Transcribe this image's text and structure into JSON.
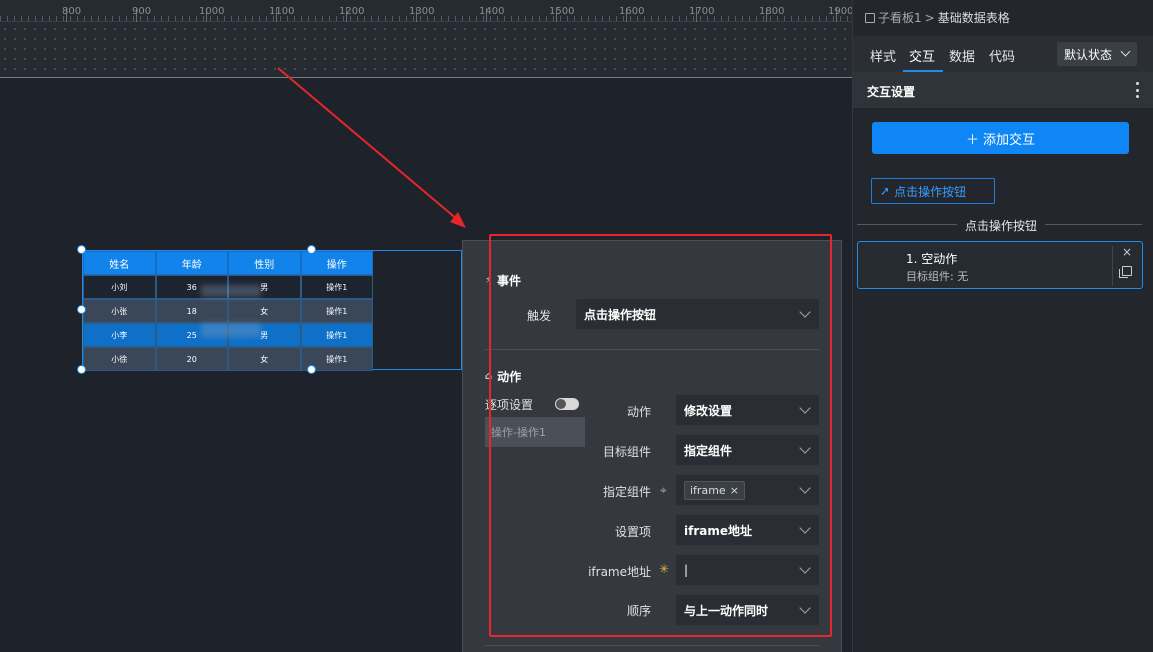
{
  "ruler": {
    "ticks": [
      "800",
      "900",
      "1000",
      "1100",
      "1200",
      "1300",
      "1400",
      "1500",
      "1600",
      "1700",
      "1800",
      "1900"
    ]
  },
  "table": {
    "headers": [
      "姓名",
      "年龄",
      "性别",
      "操作"
    ],
    "rows": [
      [
        "小刘",
        "36",
        "男",
        "操作1"
      ],
      [
        "小张",
        "18",
        "女",
        "操作1"
      ],
      [
        "小李",
        "25",
        "男",
        "操作1"
      ],
      [
        "小徐",
        "20",
        "女",
        "操作1"
      ]
    ]
  },
  "popup": {
    "event_section": {
      "icon": "lightning-icon",
      "title": "事件",
      "trigger_label": "触发",
      "trigger_value": "点击操作按钮"
    },
    "action_section": {
      "icon": "action-icon",
      "title": "动作",
      "item_settings_label": "逐项设置",
      "item_list_entry": "操作-操作1",
      "action_label": "动作",
      "action_value": "修改设置",
      "target_label": "目标组件",
      "target_value": "指定组件",
      "specified_label": "指定组件",
      "specified_tag": "iframe",
      "specified_tag_close": "×",
      "setting_label": "设置项",
      "setting_value": "iframe地址",
      "iframe_url_label": "iframe地址",
      "iframe_url_value": "|",
      "order_label": "顺序",
      "order_value": "与上一动作同时"
    }
  },
  "panel": {
    "breadcrumb": {
      "parent": "子看板1",
      "separator": ">",
      "current": "基础数据表格"
    },
    "tabs": [
      "样式",
      "交互",
      "数据",
      "代码"
    ],
    "active_tab": "交互",
    "state_select": "默认状态",
    "section_title": "交互设置",
    "add_button": "添加交互",
    "add_button_icon": "＋",
    "event_button": "点击操作按钮",
    "divider_label": "点击操作按钮",
    "action_card": {
      "title": "1. 空动作",
      "subtitle": "目标组件: 无",
      "close": "×"
    }
  },
  "colors": {
    "accent": "#1e8ce8",
    "highlight_red": "#e6262a",
    "primary_button": "#0f86f5"
  }
}
